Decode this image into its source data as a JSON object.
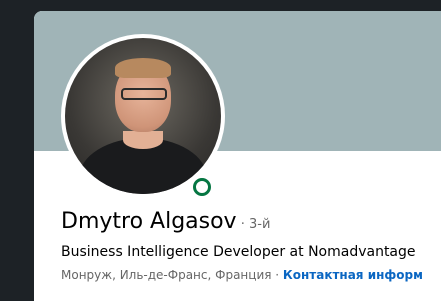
{
  "profile": {
    "name": "Dmytro Algasov",
    "degree": " · 3-й",
    "headline": "Business Intelligence Developer at Nomadvantage",
    "location": "Монруж, Иль-де-Франс, Франция",
    "separator": " · ",
    "contact_link": "Контактная информ",
    "online_status": "online"
  },
  "colors": {
    "background": "#1d2226",
    "cover": "#a0b4b7",
    "link": "#0a66c2",
    "online": "#057642"
  }
}
